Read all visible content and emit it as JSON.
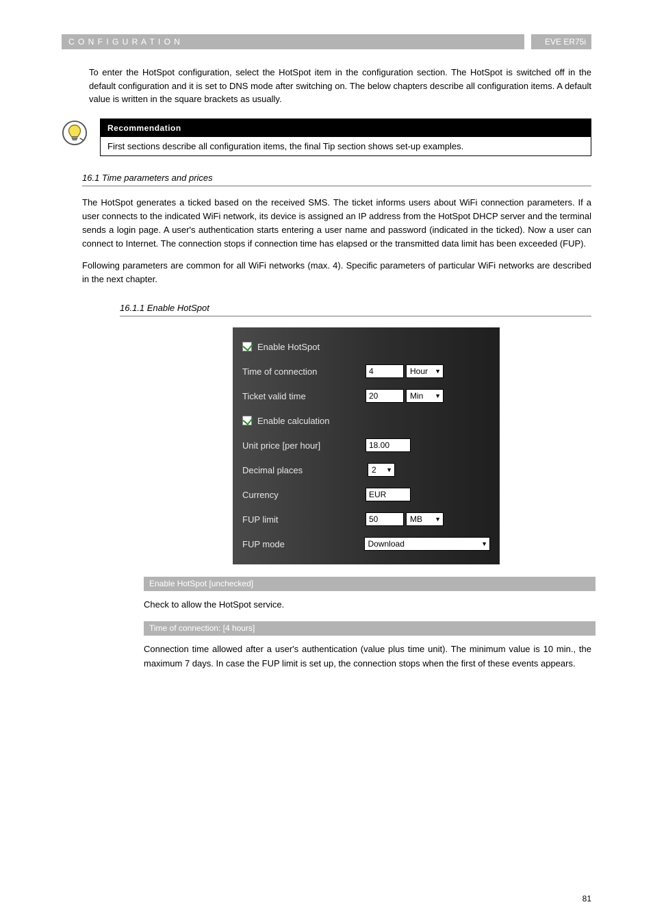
{
  "topbar": {
    "section": "C O N F I G U R A T I O N",
    "model": "EVE ER75i"
  },
  "intro": "To enter the HotSpot configuration, select the HotSpot item in the configuration section. The HotSpot is switched off in the default configuration and it is set to DNS mode after switching on. The below chapters describe all configuration items. A default value is written in the square brackets as usually.",
  "tip": {
    "header": "Recommendation",
    "body": "First sections describe all configuration items, the final Tip section shows set-up examples."
  },
  "heading_timeprice": "16.1 Time parameters and prices",
  "body1": "The HotSpot generates a ticked based on the received SMS. The ticket informs users about WiFi connection parameters. If a user connects to the indicated WiFi network, its device is assigned an IP address from the HotSpot DHCP server and the terminal sends a login page. A user's authentication starts entering a user name and password (indicated in the ticked). Now a user can connect to Internet. The connection stops if connection time has elapsed or the transmitted data limit has been exceeded (FUP).",
  "body2": "Following parameters are common for all WiFi networks (max. 4). Specific parameters of particular WiFi networks are described in the next chapter.",
  "sub_heading": "16.1.1 Enable HotSpot",
  "config": {
    "enable_hotspot_label": "Enable HotSpot",
    "time_of_connection_label": "Time of connection",
    "time_of_connection_value": "4",
    "time_of_connection_unit": "Hour",
    "ticket_valid_label": "Ticket valid time",
    "ticket_valid_value": "20",
    "ticket_valid_unit": "Min",
    "enable_calc_label": "Enable calculation",
    "unit_price_label": "Unit price [per hour]",
    "unit_price_value": "18.00",
    "decimal_places_label": "Decimal places",
    "decimal_places_value": "2",
    "currency_label": "Currency",
    "currency_value": "EUR",
    "fup_limit_label": "FUP limit",
    "fup_limit_value": "50",
    "fup_limit_unit": "MB",
    "fup_mode_label": "FUP mode",
    "fup_mode_value": "Download"
  },
  "grey1": {
    "title": "Enable HotSpot [unchecked]",
    "desc": "Check to allow the HotSpot service."
  },
  "grey2": {
    "title": "Time of connection: [4 hours]",
    "desc": "Connection time allowed after a user's authentication (value plus time unit). The minimum value is 10 min., the maximum 7 days. In case the FUP limit is set up, the connection stops when the first of these events appears."
  },
  "page_num": "81"
}
